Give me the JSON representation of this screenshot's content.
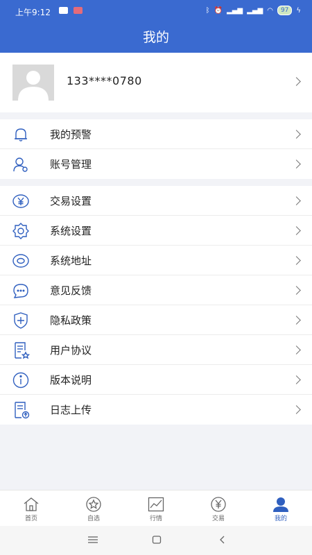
{
  "status_bar": {
    "time": "上午9:12",
    "battery": "97"
  },
  "header": {
    "title": "我的"
  },
  "profile": {
    "phone": "133****0780"
  },
  "groups": [
    [
      {
        "label": "我的预警",
        "icon": "bell-icon"
      },
      {
        "label": "账号管理",
        "icon": "account-icon"
      }
    ],
    [
      {
        "label": "交易设置",
        "icon": "yen-icon"
      },
      {
        "label": "系统设置",
        "icon": "gear-icon"
      },
      {
        "label": "系统地址",
        "icon": "eye-icon"
      },
      {
        "label": "意见反馈",
        "icon": "chat-icon"
      },
      {
        "label": "隐私政策",
        "icon": "shield-icon"
      },
      {
        "label": "用户协议",
        "icon": "document-star-icon"
      },
      {
        "label": "版本说明",
        "icon": "info-icon"
      },
      {
        "label": "日志上传",
        "icon": "upload-doc-icon"
      }
    ]
  ],
  "tabs": [
    {
      "label": "首页",
      "icon": "home-icon"
    },
    {
      "label": "自选",
      "icon": "star-icon"
    },
    {
      "label": "行情",
      "icon": "chart-icon"
    },
    {
      "label": "交易",
      "icon": "yen-icon"
    },
    {
      "label": "我的",
      "icon": "user-icon",
      "active": true
    }
  ],
  "colors": {
    "primary": "#3a6ad0",
    "icon_line": "#2f5fbf"
  }
}
